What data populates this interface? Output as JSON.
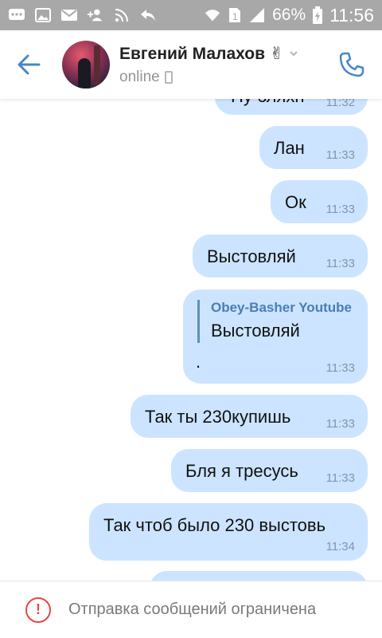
{
  "status_bar": {
    "battery": "66%",
    "time": "11:56",
    "sim": "1",
    "icons": [
      "messages-icon",
      "gallery-icon",
      "mail-icon",
      "add-user-icon",
      "rss-icon",
      "reply-icon",
      "wifi-icon",
      "sim-icon",
      "signal-icon",
      "battery-charging-icon"
    ]
  },
  "header": {
    "name": "Евгений Малахов ✌",
    "status": "online"
  },
  "messages": [
    {
      "text": "Ну бляхн",
      "time": "11:32"
    },
    {
      "text": "Лан",
      "time": "11:33"
    },
    {
      "text": "Ок",
      "time": "11:33"
    },
    {
      "text": "Выстовляй",
      "time": "11:33"
    },
    {
      "quote_name": "Obey-Basher Youtube",
      "quote_text": "Выстовляй",
      "text": ".",
      "time": "11:33"
    },
    {
      "text": "Так ты 230купишь",
      "time": "11:33"
    },
    {
      "text": "Бля я тресусь",
      "time": "11:33"
    },
    {
      "text": "Так чтоб было 230 выстовь",
      "time": "11:34"
    }
  ],
  "footer": {
    "text": "Отправка сообщений ограничена"
  },
  "colors": {
    "accent": "#4a86c8",
    "bubble": "#cce4ff",
    "status_bar": "#a8a8a8",
    "warning": "#e64646"
  }
}
